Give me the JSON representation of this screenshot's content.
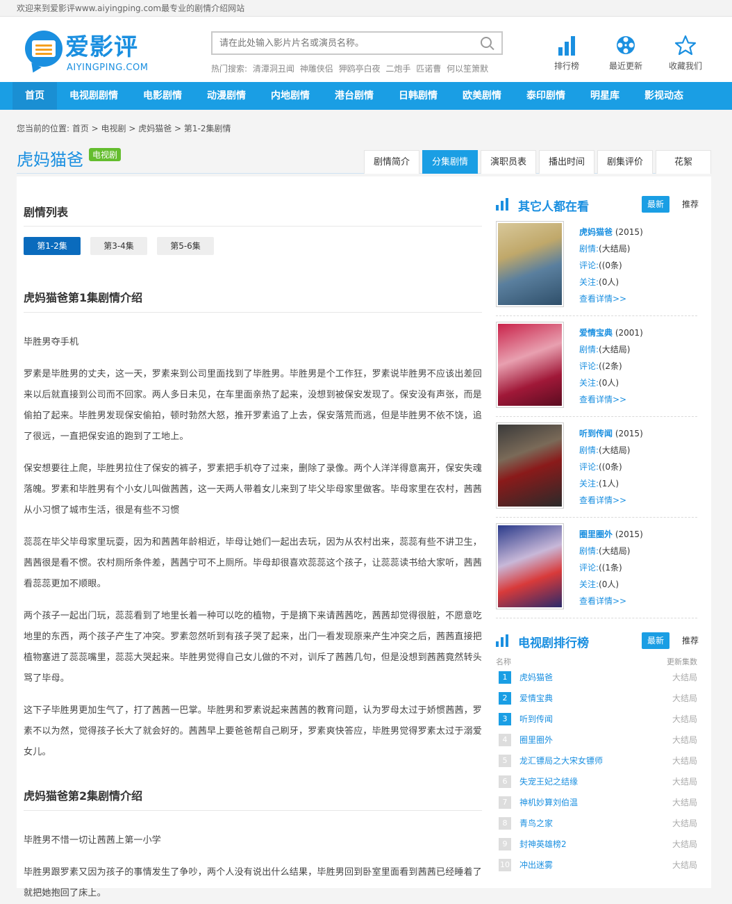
{
  "topbar": {
    "welcome": "欢迎来到爱影评www.aiyingping.com最专业的剧情介绍网站"
  },
  "logo": {
    "name": "爱影评",
    "domain": "AIYINGPING.COM"
  },
  "search": {
    "placeholder": "请在此处输入影片片名或演员名称。",
    "hot_label": "热门搜索:",
    "hot_items": [
      "清潭洞丑闻",
      "神雕侠侣",
      "狎鸥亭白夜",
      "二炮手",
      "匹诺曹",
      "何以笙箫默"
    ]
  },
  "tools": [
    {
      "label": "排行榜"
    },
    {
      "label": "最近更新"
    },
    {
      "label": "收藏我们"
    }
  ],
  "nav": [
    "首页",
    "电视剧剧情",
    "电影剧情",
    "动漫剧情",
    "内地剧情",
    "港台剧情",
    "日韩剧情",
    "欧美剧情",
    "泰印剧情",
    "明星库",
    "影视动态"
  ],
  "breadcrumb": "您当前的位置: 首页 > 电视剧 > 虎妈猫爸 > 第1-2集剧情",
  "page": {
    "title": "虎妈猫爸",
    "badge": "电视剧"
  },
  "tabs": [
    "剧情简介",
    "分集剧情",
    "演职员表",
    "播出时间",
    "剧集评价",
    "花絮"
  ],
  "left": {
    "section_title": "剧情列表",
    "episodes": [
      "第1-2集",
      "第3-4集",
      "第5-6集"
    ],
    "ep1": {
      "heading": "虎妈猫爸第1集剧情介绍",
      "paras": [
        "毕胜男夺手机",
        "罗素是毕胜男的丈夫，这一天，罗素来到公司里面找到了毕胜男。毕胜男是个工作狂，罗素说毕胜男不应该出差回来以后就直接到公司而不回家。两人多日未见，在车里面亲热了起来，没想到被保安发现了。保安没有声张，而是偷拍了起来。毕胜男发现保安偷拍，顿时勃然大怒，推开罗素追了上去，保安落荒而逃，但是毕胜男不依不饶，追了很远，一直把保安追的跑到了工地上。",
        "保安想要往上爬，毕胜男拉住了保安的裤子，罗素把手机夺了过来，删除了录像。两个人洋洋得意离开，保安失魂落魄。罗素和毕胜男有个小女儿叫做茜茜，这一天两人带着女儿来到了毕父毕母家里做客。毕母家里在农村，茜茜从小习惯了城市生活，很是有些不习惯",
        "蕊蕊在毕父毕母家里玩耍，因为和茜茜年龄相近，毕母让她们一起出去玩，因为从农村出来，蕊蕊有些不讲卫生，茜茜很是看不惯。农村厕所条件差，茜茜宁可不上厕所。毕母却很喜欢蕊蕊这个孩子，让蕊蕊读书给大家听，茜茜看蕊蕊更加不顺眼。",
        "两个孩子一起出门玩，蕊蕊看到了地里长着一种可以吃的植物，于是摘下来请茜茜吃，茜茜却觉得很脏，不愿意吃地里的东西，两个孩子产生了冲突。罗素忽然听到有孩子哭了起来，出门一看发现原来产生冲突之后，茜茜直接把植物塞进了蕊蕊嘴里，蕊蕊大哭起来。毕胜男觉得自己女儿做的不对，训斥了茜茜几句，但是没想到茜茜竟然转头骂了毕母。",
        "这下子毕胜男更加生气了，打了茜茜一巴掌。毕胜男和罗素说起来茜茜的教育问题，认为罗母太过于娇惯茜茜，罗素不以为然，觉得孩子长大了就会好的。茜茜早上要爸爸帮自己刷牙，罗素爽快答应，毕胜男觉得罗素太过于溺爱女儿。"
      ]
    },
    "ep2": {
      "heading": "虎妈猫爸第2集剧情介绍",
      "paras": [
        "毕胜男不惜一切让茜茜上第一小学",
        "毕胜男跟罗素又因为孩子的事情发生了争吵，两个人没有说出什么结果，毕胜男回到卧室里面看到茜茜已经睡着了就把她抱回了床上。"
      ]
    }
  },
  "right": {
    "others_title": "其它人都在看",
    "tab_new": "最新",
    "tab_rec": "推荐",
    "movies": [
      {
        "name": "虎妈猫爸",
        "year": "(2015)",
        "plot_lbl": "剧情:",
        "plot": "(大结局)",
        "comment_lbl": "评论:",
        "comment": "((0条)",
        "follow_lbl": "关注:",
        "follow": "(0人)",
        "more": "查看详情>>"
      },
      {
        "name": "爱情宝典",
        "year": "(2001)",
        "plot_lbl": "剧情:",
        "plot": "(大结局)",
        "comment_lbl": "评论:",
        "comment": "((2条)",
        "follow_lbl": "关注:",
        "follow": "(0人)",
        "more": "查看详情>>"
      },
      {
        "name": "听到传闻",
        "year": "(2015)",
        "plot_lbl": "剧情:",
        "plot": "(大结局)",
        "comment_lbl": "评论:",
        "comment": "((0条)",
        "follow_lbl": "关注:",
        "follow": "(1人)",
        "more": "查看详情>>"
      },
      {
        "name": "圈里圈外",
        "year": "(2015)",
        "plot_lbl": "剧情:",
        "plot": "(大结局)",
        "comment_lbl": "评论:",
        "comment": "((1条)",
        "follow_lbl": "关注:",
        "follow": "(0人)",
        "more": "查看详情>>"
      }
    ],
    "rank_title": "电视剧排行榜",
    "rank_col_name": "名称",
    "rank_col_stat": "更新集数",
    "ranks": [
      {
        "n": "1",
        "name": "虎妈猫爸",
        "stat": "大结局"
      },
      {
        "n": "2",
        "name": "爱情宝典",
        "stat": "大结局"
      },
      {
        "n": "3",
        "name": "听到传闻",
        "stat": "大结局"
      },
      {
        "n": "4",
        "name": "圈里圈外",
        "stat": "大结局"
      },
      {
        "n": "5",
        "name": "龙汇镖局之大宋女镖师",
        "stat": "大结局"
      },
      {
        "n": "6",
        "name": "失宠王妃之结缘",
        "stat": "大结局"
      },
      {
        "n": "7",
        "name": "神机妙算刘伯温",
        "stat": "大结局"
      },
      {
        "n": "8",
        "name": "青鸟之家",
        "stat": "大结局"
      },
      {
        "n": "9",
        "name": "封神英雄榜2",
        "stat": "大结局"
      },
      {
        "n": "10",
        "name": "冲出迷雾",
        "stat": "大结局"
      }
    ]
  },
  "colors": {
    "brand": "#1a9ee4",
    "nav_active": "#1a8fd3",
    "badge": "#64bd2e"
  },
  "icons": {
    "tool1": "bar-chart-icon",
    "tool2": "film-reel-icon",
    "tool3": "star-icon"
  }
}
